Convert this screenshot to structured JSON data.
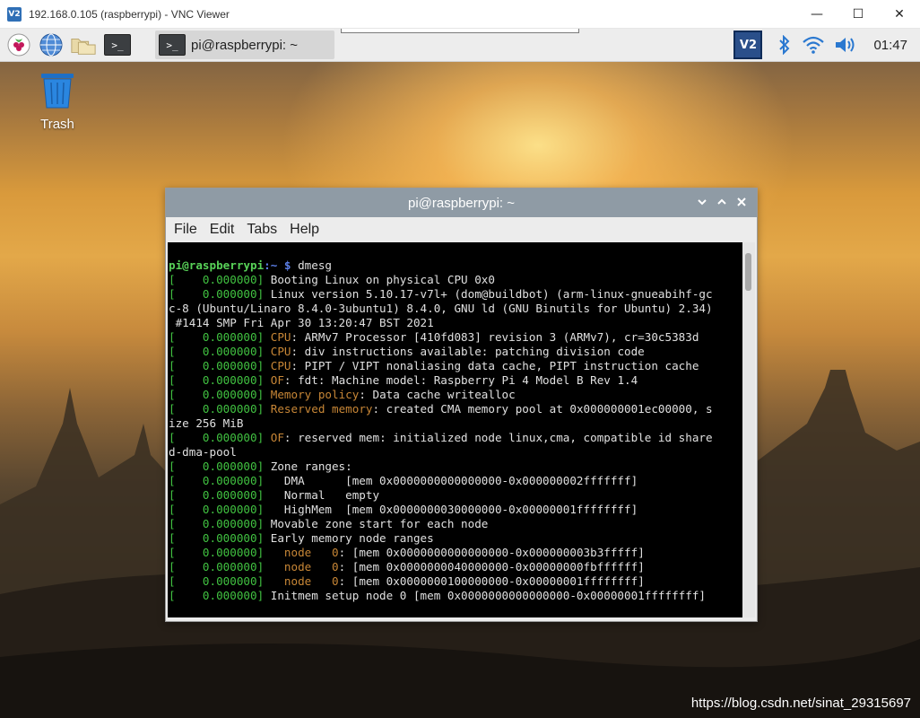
{
  "vnc_window": {
    "title": "192.168.0.105 (raspberrypi) - VNC Viewer",
    "logo_text": "V2",
    "controls": {
      "minimize": "—",
      "maximize": "☐",
      "close": "✕"
    }
  },
  "panel": {
    "taskbar_button_label": "pi@raspberrypi: ~",
    "terminal_glyph": ">_",
    "clock": "01:47",
    "vnc_tray_text": "V2"
  },
  "desktop": {
    "trash_label": "Trash"
  },
  "terminal": {
    "title": "pi@raspberrypi: ~",
    "menu": [
      "File",
      "Edit",
      "Tabs",
      "Help"
    ],
    "prompt_user": "pi@raspberrypi",
    "prompt_path": ":~ ",
    "prompt_symbol": "$ ",
    "command": "dmesg",
    "lines": [
      [
        [
          "ts",
          "[    0.000000]"
        ],
        [
          "tx",
          " Booting Linux on physical CPU 0x0"
        ]
      ],
      [
        [
          "ts",
          "[    0.000000]"
        ],
        [
          "tx",
          " Linux version 5.10.17-v7l+ (dom@buildbot) (arm-linux-gnueabihf-gc"
        ]
      ],
      [
        [
          "tx",
          "c-8 (Ubuntu/Linaro 8.4.0-3ubuntu1) 8.4.0, GNU ld (GNU Binutils for Ubuntu) 2.34)"
        ]
      ],
      [
        [
          "tx",
          " #1414 SMP Fri Apr 30 13:20:47 BST 2021"
        ]
      ],
      [
        [
          "ts",
          "[    0.000000]"
        ],
        [
          "tx",
          " "
        ],
        [
          "hl",
          "CPU"
        ],
        [
          "tx",
          ": ARMv7 Processor [410fd083] revision 3 (ARMv7), cr=30c5383d"
        ]
      ],
      [
        [
          "ts",
          "[    0.000000]"
        ],
        [
          "tx",
          " "
        ],
        [
          "hl",
          "CPU"
        ],
        [
          "tx",
          ": div instructions available: patching division code"
        ]
      ],
      [
        [
          "ts",
          "[    0.000000]"
        ],
        [
          "tx",
          " "
        ],
        [
          "hl",
          "CPU"
        ],
        [
          "tx",
          ": PIPT / VIPT nonaliasing data cache, PIPT instruction cache"
        ]
      ],
      [
        [
          "ts",
          "[    0.000000]"
        ],
        [
          "tx",
          " "
        ],
        [
          "hl",
          "OF"
        ],
        [
          "tx",
          ": fdt: Machine model: Raspberry Pi 4 Model B Rev 1.4"
        ]
      ],
      [
        [
          "ts",
          "[    0.000000]"
        ],
        [
          "tx",
          " "
        ],
        [
          "hl",
          "Memory policy"
        ],
        [
          "tx",
          ": Data cache writealloc"
        ]
      ],
      [
        [
          "ts",
          "[    0.000000]"
        ],
        [
          "tx",
          " "
        ],
        [
          "hl",
          "Reserved memory"
        ],
        [
          "tx",
          ": created CMA memory pool at 0x000000001ec00000, s"
        ]
      ],
      [
        [
          "tx",
          "ize 256 MiB"
        ]
      ],
      [
        [
          "ts",
          "[    0.000000]"
        ],
        [
          "tx",
          " "
        ],
        [
          "hl",
          "OF"
        ],
        [
          "tx",
          ": reserved mem: initialized node linux,cma, compatible id share"
        ]
      ],
      [
        [
          "tx",
          "d-dma-pool"
        ]
      ],
      [
        [
          "ts",
          "[    0.000000]"
        ],
        [
          "tx",
          " Zone ranges:"
        ]
      ],
      [
        [
          "ts",
          "[    0.000000]"
        ],
        [
          "tx",
          "   DMA      [mem 0x0000000000000000-0x000000002fffffff]"
        ]
      ],
      [
        [
          "ts",
          "[    0.000000]"
        ],
        [
          "tx",
          "   Normal   empty"
        ]
      ],
      [
        [
          "ts",
          "[    0.000000]"
        ],
        [
          "tx",
          "   HighMem  [mem 0x0000000030000000-0x00000001ffffffff]"
        ]
      ],
      [
        [
          "ts",
          "[    0.000000]"
        ],
        [
          "tx",
          " Movable zone start for each node"
        ]
      ],
      [
        [
          "ts",
          "[    0.000000]"
        ],
        [
          "tx",
          " Early memory node ranges"
        ]
      ],
      [
        [
          "ts",
          "[    0.000000]"
        ],
        [
          "tx",
          "   "
        ],
        [
          "hl",
          "node   0"
        ],
        [
          "tx",
          ": [mem 0x0000000000000000-0x000000003b3fffff]"
        ]
      ],
      [
        [
          "ts",
          "[    0.000000]"
        ],
        [
          "tx",
          "   "
        ],
        [
          "hl",
          "node   0"
        ],
        [
          "tx",
          ": [mem 0x0000000040000000-0x00000000fbffffff]"
        ]
      ],
      [
        [
          "ts",
          "[    0.000000]"
        ],
        [
          "tx",
          "   "
        ],
        [
          "hl",
          "node   0"
        ],
        [
          "tx",
          ": [mem 0x0000000100000000-0x00000001ffffffff]"
        ]
      ],
      [
        [
          "ts",
          "[    0.000000]"
        ],
        [
          "tx",
          " Initmem setup node 0 [mem 0x0000000000000000-0x00000001ffffffff]"
        ]
      ]
    ]
  },
  "watermark": "https://blog.csdn.net/sinat_29315697",
  "colors": {
    "timestamp": "#41c241",
    "highlight": "#c78636",
    "prompt_user": "#58d258",
    "prompt_path": "#5c7fe8",
    "terminal_title_bar": "#8f9ba5"
  }
}
